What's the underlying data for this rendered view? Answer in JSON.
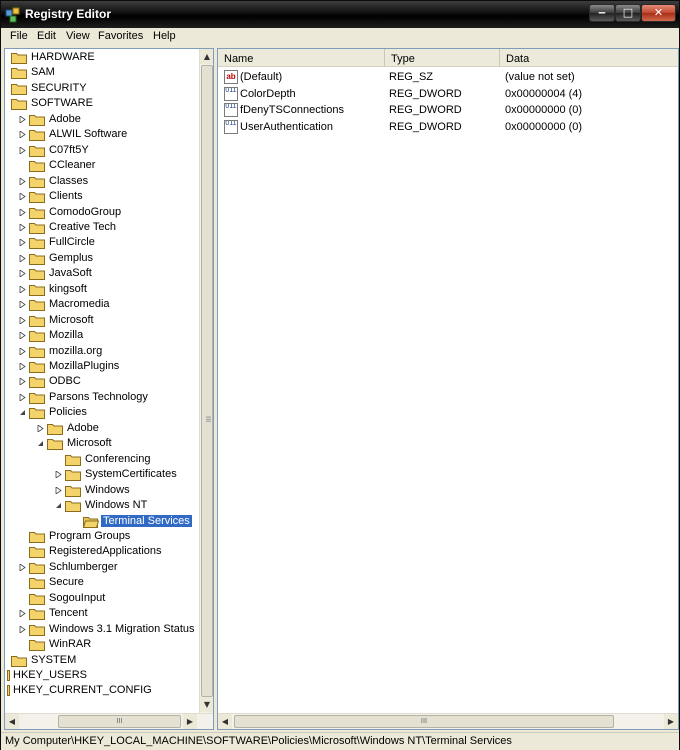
{
  "window": {
    "title": "Registry Editor",
    "controls": {
      "minimize": "‒",
      "maximize": "□",
      "close": "✕"
    }
  },
  "menu": [
    "File",
    "Edit",
    "View",
    "Favorites",
    "Help"
  ],
  "tree": [
    {
      "label": "HARDWARE",
      "level": 0,
      "expander": "none"
    },
    {
      "label": "SAM",
      "level": 0,
      "expander": "none"
    },
    {
      "label": "SECURITY",
      "level": 0,
      "expander": "none"
    },
    {
      "label": "SOFTWARE",
      "level": 0,
      "expander": "none"
    },
    {
      "label": "Adobe",
      "level": 1,
      "expander": "collapsed"
    },
    {
      "label": "ALWIL Software",
      "level": 1,
      "expander": "collapsed"
    },
    {
      "label": "C07ft5Y",
      "level": 1,
      "expander": "collapsed"
    },
    {
      "label": "CCleaner",
      "level": 1,
      "expander": "none"
    },
    {
      "label": "Classes",
      "level": 1,
      "expander": "collapsed"
    },
    {
      "label": "Clients",
      "level": 1,
      "expander": "collapsed"
    },
    {
      "label": "ComodoGroup",
      "level": 1,
      "expander": "collapsed"
    },
    {
      "label": "Creative Tech",
      "level": 1,
      "expander": "collapsed"
    },
    {
      "label": "FullCircle",
      "level": 1,
      "expander": "collapsed"
    },
    {
      "label": "Gemplus",
      "level": 1,
      "expander": "collapsed"
    },
    {
      "label": "JavaSoft",
      "level": 1,
      "expander": "collapsed"
    },
    {
      "label": "kingsoft",
      "level": 1,
      "expander": "collapsed"
    },
    {
      "label": "Macromedia",
      "level": 1,
      "expander": "collapsed"
    },
    {
      "label": "Microsoft",
      "level": 1,
      "expander": "collapsed"
    },
    {
      "label": "Mozilla",
      "level": 1,
      "expander": "collapsed"
    },
    {
      "label": "mozilla.org",
      "level": 1,
      "expander": "collapsed"
    },
    {
      "label": "MozillaPlugins",
      "level": 1,
      "expander": "collapsed"
    },
    {
      "label": "ODBC",
      "level": 1,
      "expander": "collapsed"
    },
    {
      "label": "Parsons Technology",
      "level": 1,
      "expander": "collapsed"
    },
    {
      "label": "Policies",
      "level": 1,
      "expander": "expanded"
    },
    {
      "label": "Adobe",
      "level": 2,
      "expander": "collapsed"
    },
    {
      "label": "Microsoft",
      "level": 2,
      "expander": "expanded"
    },
    {
      "label": "Conferencing",
      "level": 3,
      "expander": "none"
    },
    {
      "label": "SystemCertificates",
      "level": 3,
      "expander": "collapsed"
    },
    {
      "label": "Windows",
      "level": 3,
      "expander": "collapsed"
    },
    {
      "label": "Windows NT",
      "level": 3,
      "expander": "expanded"
    },
    {
      "label": "Terminal Services",
      "level": 4,
      "expander": "none",
      "selected": true
    },
    {
      "label": "Program Groups",
      "level": 1,
      "expander": "none"
    },
    {
      "label": "RegisteredApplications",
      "level": 1,
      "expander": "none"
    },
    {
      "label": "Schlumberger",
      "level": 1,
      "expander": "collapsed"
    },
    {
      "label": "Secure",
      "level": 1,
      "expander": "none"
    },
    {
      "label": "SogouInput",
      "level": 1,
      "expander": "none"
    },
    {
      "label": "Tencent",
      "level": 1,
      "expander": "collapsed"
    },
    {
      "label": "Windows 3.1 Migration Status",
      "level": 1,
      "expander": "collapsed"
    },
    {
      "label": "WinRAR",
      "level": 1,
      "expander": "none"
    },
    {
      "label": "SYSTEM",
      "level": 0,
      "expander": "none"
    },
    {
      "label": "HKEY_USERS",
      "level": -1,
      "expander": "none"
    },
    {
      "label": "HKEY_CURRENT_CONFIG",
      "level": -1,
      "expander": "none"
    }
  ],
  "columns": {
    "name": "Name",
    "type": "Type",
    "data": "Data"
  },
  "values": [
    {
      "icon": "string-value-icon",
      "glyph": "ab",
      "name": "(Default)",
      "type": "REG_SZ",
      "data": "(value not set)"
    },
    {
      "icon": "dword-value-icon",
      "glyph": "011",
      "name": "ColorDepth",
      "type": "REG_DWORD",
      "data": "0x00000004 (4)"
    },
    {
      "icon": "dword-value-icon",
      "glyph": "011",
      "name": "fDenyTSConnections",
      "type": "REG_DWORD",
      "data": "0x00000000 (0)"
    },
    {
      "icon": "dword-value-icon",
      "glyph": "011",
      "name": "UserAuthentication",
      "type": "REG_DWORD",
      "data": "0x00000000 (0)"
    }
  ],
  "scrollbars": {
    "grip": "III",
    "up": "▲",
    "down": "▼",
    "left": "◀",
    "right": "▶"
  },
  "status": "My Computer\\HKEY_LOCAL_MACHINE\\SOFTWARE\\Policies\\Microsoft\\Windows NT\\Terminal Services",
  "colors": {
    "selection": "#316ac5",
    "folder": "#f5d36b",
    "titlebar": "#000000"
  }
}
